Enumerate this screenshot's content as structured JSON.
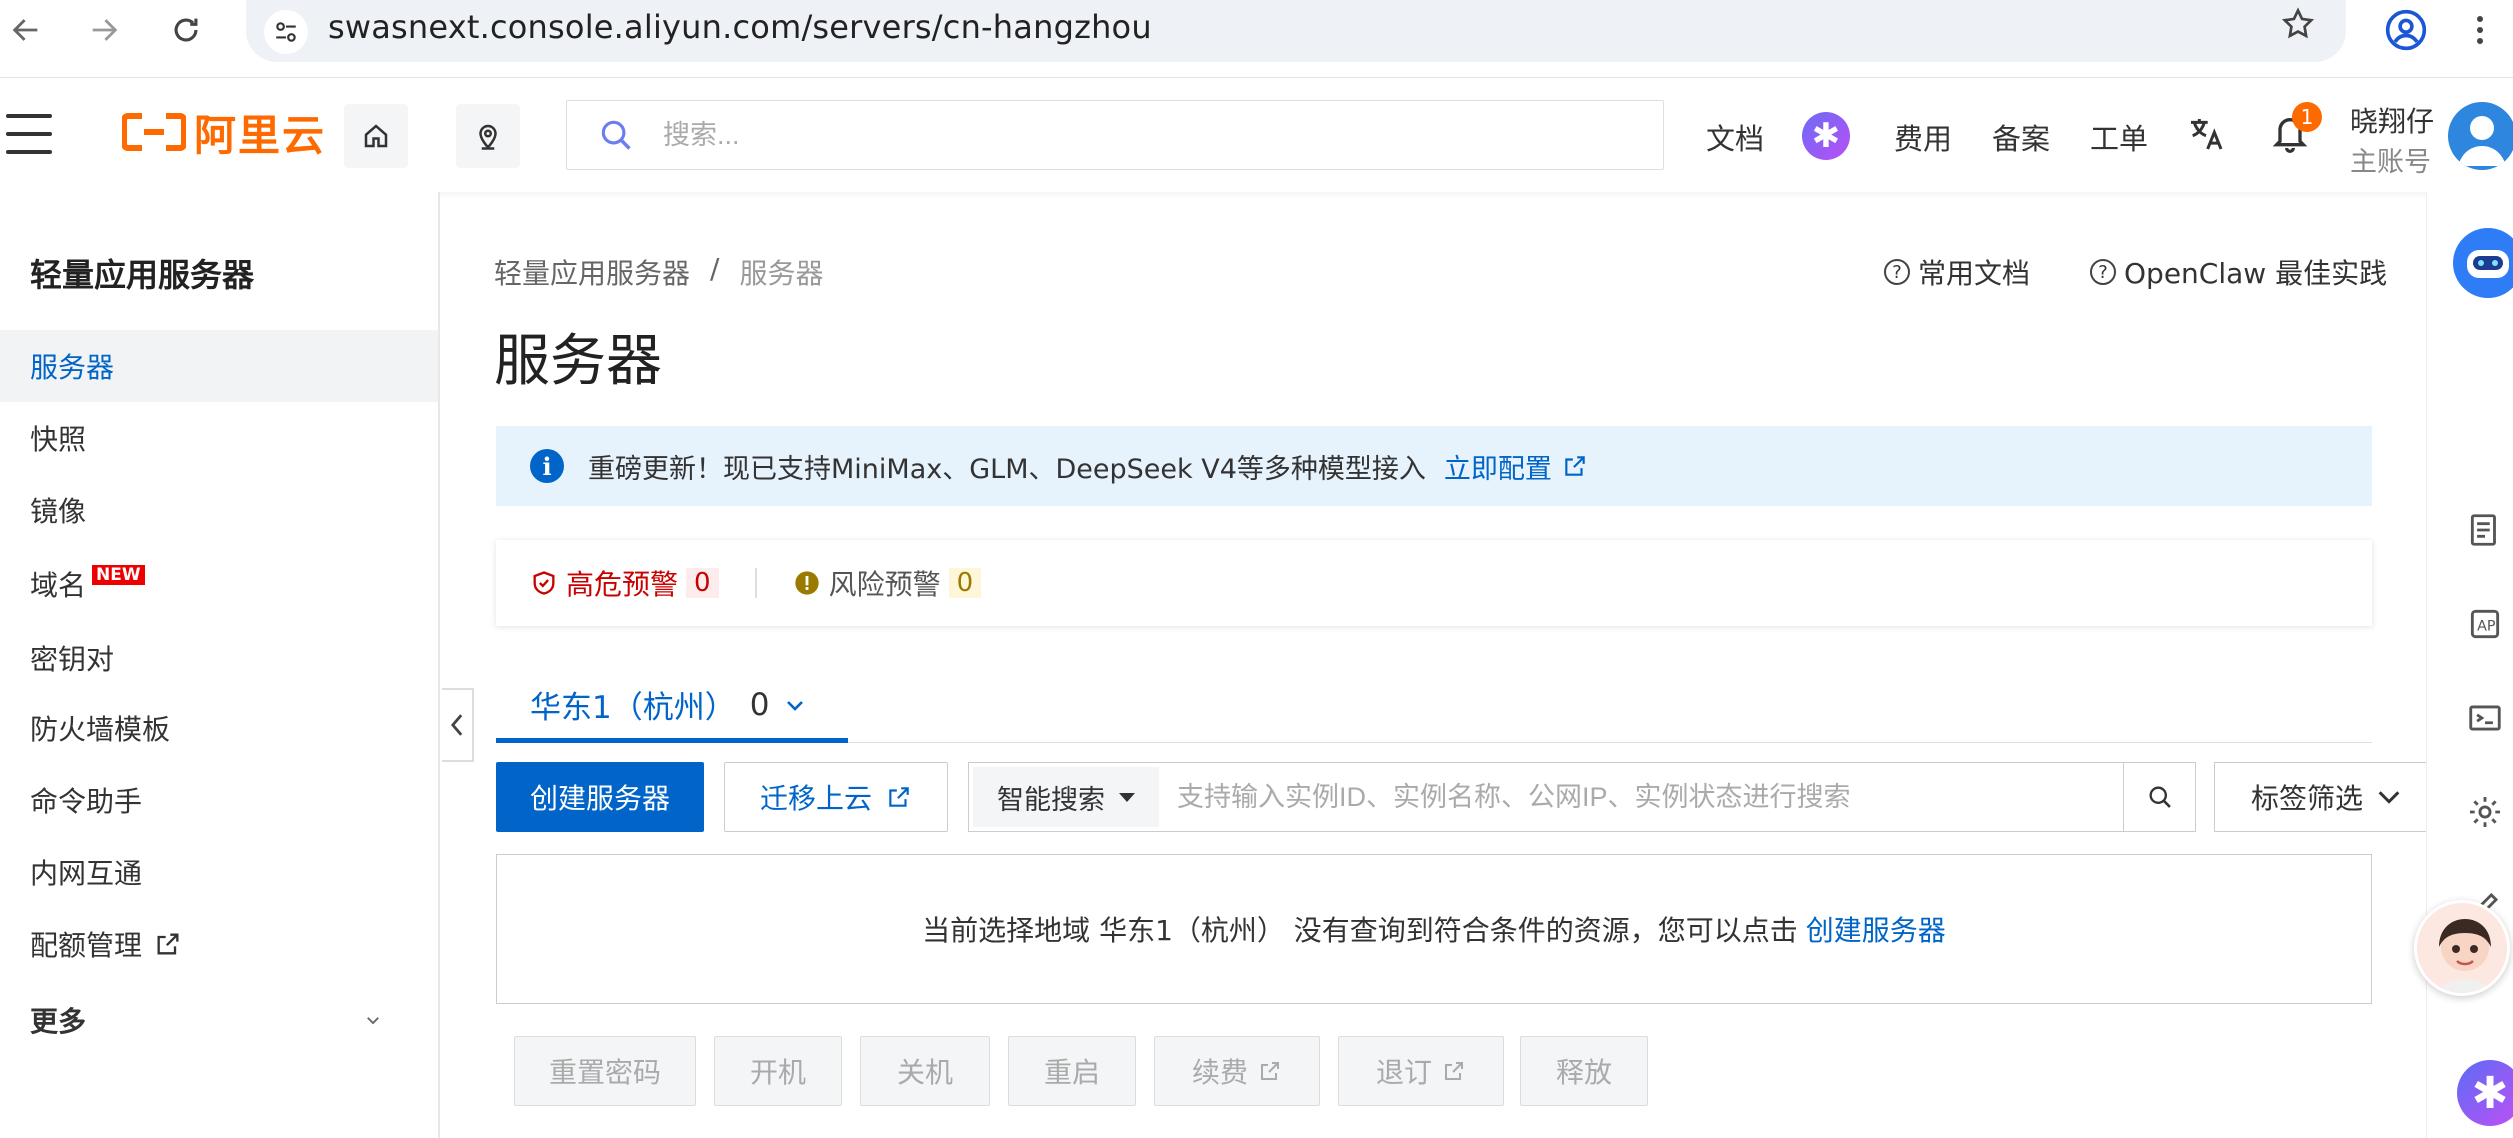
{
  "browser": {
    "url": "swasnext.console.aliyun.com/servers/cn-hangzhou"
  },
  "header": {
    "logo_text": "阿里云",
    "search_placeholder": "搜索...",
    "links": [
      "文档",
      "费用",
      "备案",
      "工单"
    ],
    "notification_count": "1",
    "user_name": "晓翔仔",
    "user_role": "主账号"
  },
  "sidebar": {
    "title": "轻量应用服务器",
    "items": [
      {
        "label": "服务器",
        "active": true
      },
      {
        "label": "快照"
      },
      {
        "label": "镜像"
      },
      {
        "label": "域名",
        "tag": "NEW"
      },
      {
        "label": "密钥对"
      },
      {
        "label": "防火墙模板"
      },
      {
        "label": "命令助手"
      },
      {
        "label": "内网互通"
      },
      {
        "label": "配额管理"
      }
    ],
    "more_label": "更多"
  },
  "breadcrumb": [
    "轻量应用服务器",
    "/",
    "服务器"
  ],
  "top_links": [
    "常用文档",
    "OpenClaw 最佳实践"
  ],
  "page_title": "服务器",
  "notice": {
    "text": "重磅更新！现已支持MiniMax、GLM、DeepSeek V4等多种模型接入",
    "link": "立即配置"
  },
  "alerts": {
    "high_label": "高危预警",
    "high_count": "0",
    "risk_label": "风险预警",
    "risk_count": "0"
  },
  "region_tab": {
    "label": "华东1（杭州）",
    "count": "0"
  },
  "toolbar": {
    "create_label": "创建服务器",
    "migrate_label": "迁移上云",
    "smart_search_label": "智能搜索",
    "search_placeholder": "支持输入实例ID、实例名称、公网IP、实例状态进行搜索",
    "tag_filter_label": "标签筛选"
  },
  "empty_state": {
    "text": "当前选择地域 华东1（杭州） 没有查询到符合条件的资源，您可以点击",
    "link": "创建服务器"
  },
  "actions": [
    "重置密码",
    "开机",
    "关机",
    "重启",
    "续费",
    "退订",
    "释放"
  ],
  "colors": {
    "brand_orange": "#ff6a00",
    "primary_blue": "#0064c8",
    "danger_red": "#c80000",
    "warning_yellow": "#9a7b00"
  }
}
